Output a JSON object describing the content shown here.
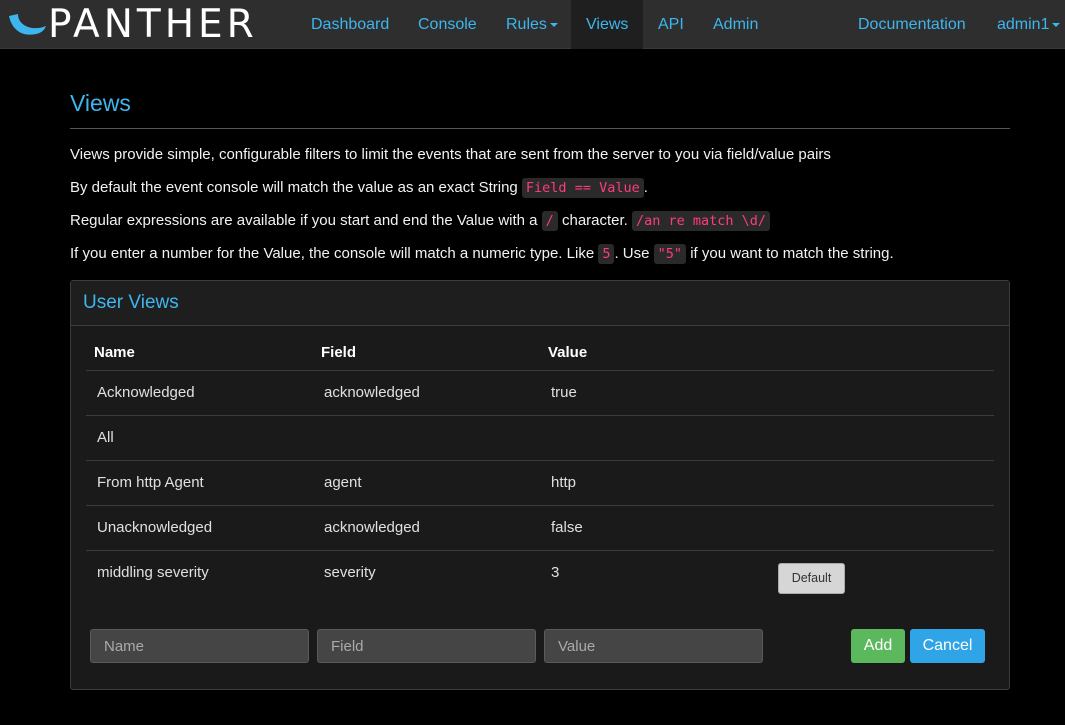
{
  "brand": {
    "name": "PANTHER"
  },
  "nav": {
    "items": [
      {
        "label": "Dashboard"
      },
      {
        "label": "Console"
      },
      {
        "label": "Rules"
      },
      {
        "label": "Views"
      },
      {
        "label": "API"
      },
      {
        "label": "Admin"
      }
    ],
    "right": [
      {
        "label": "Documentation"
      },
      {
        "label": "admin1"
      }
    ],
    "active": "Views"
  },
  "page": {
    "title": "Views",
    "p1": "Views provide simple, configurable filters to limit the events that are sent from the server to you via field/value pairs",
    "p2_pre": "By default the event console will match the value as an exact String ",
    "p2_code": "Field == Value",
    "p2_post": ".",
    "p3_pre": "Regular expressions are available if you start and end the Value with a ",
    "p3_code1": "/",
    "p3_mid": " character. ",
    "p3_code2": "/an re match \\d/",
    "p4_pre": "If you enter a number for the Value, the console will match a numeric type. Like ",
    "p4_code1": "5",
    "p4_mid": ". Use ",
    "p4_code2": "\"5\"",
    "p4_post": " if you want to match the string."
  },
  "panel": {
    "title": "User Views",
    "columns": {
      "name": "Name",
      "field": "Field",
      "value": "Value"
    },
    "rows": [
      {
        "name": "Acknowledged",
        "field": "acknowledged",
        "value": "true"
      },
      {
        "name": "All",
        "field": "",
        "value": ""
      },
      {
        "name": "From http Agent",
        "field": "agent",
        "value": "http"
      },
      {
        "name": "Unacknowledged",
        "field": "acknowledged",
        "value": "false"
      },
      {
        "name": "middling severity",
        "field": "severity",
        "value": "3",
        "action": "Default"
      }
    ],
    "form": {
      "name_placeholder": "Name",
      "field_placeholder": "Field",
      "value_placeholder": "Value",
      "add_label": "Add",
      "cancel_label": "Cancel"
    }
  },
  "colors": {
    "accent": "#3db6ee",
    "navbar_bg": "#2e2e2e",
    "add_button": "#5cb85c",
    "cancel_button": "#2fa4e7",
    "code_text": "#ff3b7f"
  }
}
